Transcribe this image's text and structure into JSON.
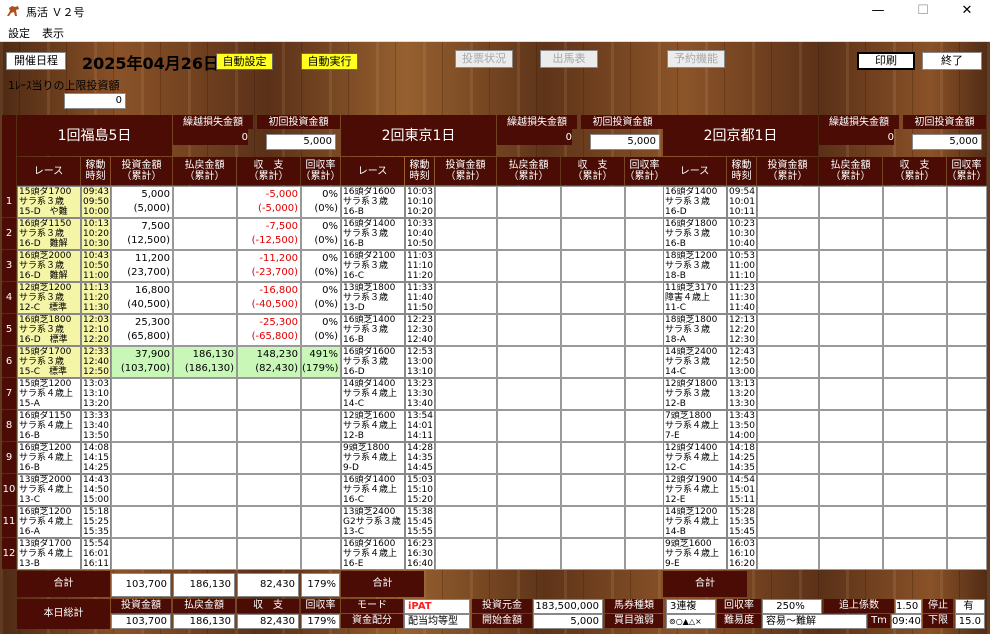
{
  "window": {
    "title": "馬活 Ｖ２号",
    "minimize": "—",
    "maximize": "☐",
    "close": "✕"
  },
  "menu": [
    "設定",
    "表示"
  ],
  "toolbar": {
    "schedule": "開催日程",
    "date": "2025年04月26日",
    "auto_setting": "自動設定",
    "auto_run": "自動実行",
    "vote_status": "投票状況",
    "entries": "出馬表",
    "reserve": "予約機能",
    "print": "印刷",
    "exit": "終了"
  },
  "limit": {
    "label": "1ﾚｰｽ当りの上限投資額",
    "value": "0"
  },
  "header_labels": {
    "loss": "繰越損失金額",
    "init": "初回投資金額",
    "race": "レース",
    "active": "稼動\n時刻",
    "invest": "投資金額\n（累計）",
    "payout": "払戻金額\n（累計）",
    "balance": "収　支\n（累計）",
    "rate": "回収率\n（累計）"
  },
  "venues": [
    {
      "name": "1回福島5日",
      "loss": "0",
      "init": "5,000"
    },
    {
      "name": "2回東京1日",
      "loss": "0",
      "init": "5,000"
    },
    {
      "name": "2回京都1日",
      "loss": "0",
      "init": "5,000"
    }
  ],
  "races": [
    {
      "no": "1",
      "fk": "15頭ダ1700\nサラ系３歳\n15-D　や難",
      "ft": "09:43\n09:50\n10:00",
      "inv": "5,000\n(5,000)",
      "pay": "",
      "bal": "-5,000\n(-5,000)",
      "rate": "0%\n(0%)",
      "tk": "16頭ダ1600\nサラ系３歳\n16-B",
      "tt": "10:03\n10:10\n10:20",
      "ky": "16頭ダ1400\nサラ系３歳\n16-D",
      "kt": "09:54\n10:01\n10:11"
    },
    {
      "no": "2",
      "fk": "16頭ダ1150\nサラ系３歳\n16-D　難解",
      "ft": "10:13\n10:20\n10:30",
      "inv": "7,500\n(12,500)",
      "pay": "",
      "bal": "-7,500\n(-12,500)",
      "rate": "0%\n(0%)",
      "tk": "16頭ダ1400\nサラ系３歳\n16-B",
      "tt": "10:33\n10:40\n10:50",
      "ky": "16頭ダ1800\nサラ系３歳\n16-B",
      "kt": "10:23\n10:30\n10:40"
    },
    {
      "no": "3",
      "fk": "16頭芝2000\nサラ系３歳\n16-D　難解",
      "ft": "10:43\n10:50\n11:00",
      "inv": "11,200\n(23,700)",
      "pay": "",
      "bal": "-11,200\n(-23,700)",
      "rate": "0%\n(0%)",
      "tk": "16頭ダ2100\nサラ系３歳\n16-C",
      "tt": "11:03\n11:10\n11:20",
      "ky": "18頭芝1200\nサラ系３歳\n18-B",
      "kt": "10:53\n11:00\n11:10"
    },
    {
      "no": "4",
      "fk": "12頭芝1200\nサラ系３歳\n12-C　標準",
      "ft": "11:13\n11:20\n11:30",
      "inv": "16,800\n(40,500)",
      "pay": "",
      "bal": "-16,800\n(-40,500)",
      "rate": "0%\n(0%)",
      "tk": "13頭芝1800\nサラ系３歳\n13-D",
      "tt": "11:33\n11:40\n11:50",
      "ky": "11頭芝3170\n障害４歳上\n11-C",
      "kt": "11:23\n11:30\n11:40"
    },
    {
      "no": "5",
      "fk": "16頭芝1800\nサラ系３歳\n16-D　標準",
      "ft": "12:03\n12:10\n12:20",
      "inv": "25,300\n(65,800)",
      "pay": "",
      "bal": "-25,300\n(-65,800)",
      "rate": "0%\n(0%)",
      "tk": "16頭芝1400\nサラ系３歳\n16-B",
      "tt": "12:23\n12:30\n12:40",
      "ky": "18頭芝1800\nサラ系３歳\n18-A",
      "kt": "12:13\n12:20\n12:30"
    },
    {
      "no": "6",
      "fk": "15頭ダ1700\nサラ系３歳\n15-C　標準",
      "ft": "12:33\n12:40\n12:50",
      "inv": "37,900\n(103,700)",
      "pay": "186,130\n(186,130)",
      "bal": "148,230\n(82,430)",
      "rate": "491%\n(179%)",
      "tk": "16頭ダ1600\nサラ系３歳\n16-D",
      "tt": "12:53\n13:00\n13:10",
      "ky": "14頭芝2400\nサラ系３歳\n14-C",
      "kt": "12:43\n12:50\n13:00"
    },
    {
      "no": "7",
      "fk": "15頭芝1200\nサラ系４歳上\n15-A",
      "ft": "13:03\n13:10\n13:20",
      "inv": "",
      "pay": "",
      "bal": "",
      "rate": "",
      "tk": "14頭ダ1400\nサラ系４歳上\n14-C",
      "tt": "13:23\n13:30\n13:40",
      "ky": "12頭ダ1800\nサラ系３歳\n12-B",
      "kt": "13:13\n13:20\n13:30"
    },
    {
      "no": "8",
      "fk": "16頭ダ1150\nサラ系４歳上\n16-B",
      "ft": "13:33\n13:40\n13:50",
      "inv": "",
      "pay": "",
      "bal": "",
      "rate": "",
      "tk": "12頭芝1600\nサラ系４歳上\n12-B",
      "tt": "13:54\n14:01\n14:11",
      "ky": "7頭芝1800\nサラ系４歳上\n7-E",
      "kt": "13:43\n13:50\n14:00"
    },
    {
      "no": "9",
      "fk": "16頭芝1200\nサラ系４歳上\n16-B",
      "ft": "14:08\n14:15\n14:25",
      "inv": "",
      "pay": "",
      "bal": "",
      "rate": "",
      "tk": "9頭芝1800\nサラ系４歳上\n9-D",
      "tt": "14:28\n14:35\n14:45",
      "ky": "12頭ダ1400\nサラ系４歳上\n12-C",
      "kt": "14:18\n14:25\n14:35"
    },
    {
      "no": "10",
      "fk": "13頭芝2000\nサラ系４歳上\n13-C",
      "ft": "14:43\n14:50\n15:00",
      "inv": "",
      "pay": "",
      "bal": "",
      "rate": "",
      "tk": "16頭ダ1400\nサラ系４歳上\n16-C",
      "tt": "15:03\n15:10\n15:20",
      "ky": "12頭ダ1900\nサラ系４歳上\n12-E",
      "kt": "14:54\n15:01\n15:11"
    },
    {
      "no": "11",
      "fk": "16頭芝1200\nサラ系４歳上\n16-A",
      "ft": "15:18\n15:25\n15:35",
      "inv": "",
      "pay": "",
      "bal": "",
      "rate": "",
      "tk": "13頭芝2400\nG2サラ系３歳\n13-C",
      "tt": "15:38\n15:45\n15:55",
      "ky": "14頭芝1200\nサラ系４歳上\n14-B",
      "kt": "15:28\n15:35\n15:45"
    },
    {
      "no": "12",
      "fk": "13頭ダ1700\nサラ系４歳上\n13-B",
      "ft": "15:54\n16:01\n16:11",
      "inv": "",
      "pay": "",
      "bal": "",
      "rate": "",
      "tk": "16頭ダ1600\nサラ系４歳上\n16-E",
      "tt": "16:23\n16:30\n16:40",
      "ky": "9頭芝1600\nサラ系４歳上\n9-E",
      "kt": "16:03\n16:10\n16:20"
    }
  ],
  "totals": {
    "label": "合計",
    "inv": "103,700",
    "pay": "186,130",
    "bal": "82,430",
    "rate": "179%"
  },
  "today": {
    "label": "本日総計",
    "inv_label": "投資金額",
    "pay_label": "払戻金額",
    "bal_label": "収　支",
    "rate_label": "回収率",
    "inv": "103,700",
    "pay": "186,130",
    "bal": "82,430",
    "rate": "179%",
    "mode_label": "モード",
    "mode": "iPAT",
    "alloc_label": "資金配分",
    "alloc": "配当均等型",
    "capital_label": "投資元金",
    "capital": "183,500,000",
    "start_label": "開始金額",
    "start": "5,000",
    "type_label": "馬券種類",
    "type": "3連複",
    "strength_label": "買目強弱",
    "strength": "⊚○▲△×",
    "recov_label": "回収率",
    "recov": "250%",
    "difficulty_label": "難易度",
    "difficulty": "容易～難解",
    "coef_label": "追上係数",
    "coef": "1.50",
    "stop_label": "停止",
    "stop": "有",
    "tm_label": "Tm",
    "tm": "09:40",
    "lower_label": "下限",
    "lower": "15.0"
  }
}
